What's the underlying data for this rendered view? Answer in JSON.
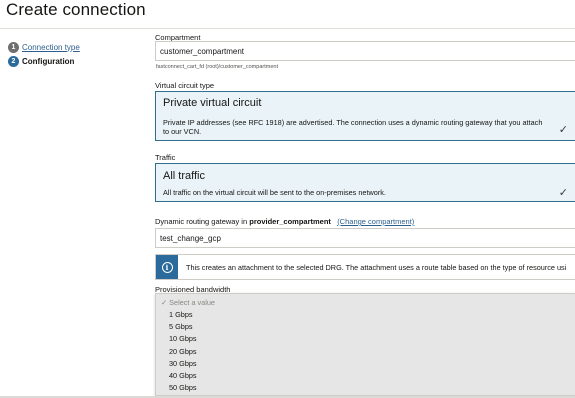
{
  "page": {
    "title": "Create connection"
  },
  "steps": [
    {
      "number": "1",
      "label": "Connection type"
    },
    {
      "number": "2",
      "label": "Configuration"
    }
  ],
  "compartment": {
    "label": "Compartment",
    "value": "customer_compartment",
    "hint": "fastconnect_cart_fd (root)/customer_compartment"
  },
  "virtual_circuit": {
    "label": "Virtual circuit type",
    "title": "Private virtual circuit",
    "description_line1": "Private IP addresses (see RFC 1918) are advertised. The connection uses a dynamic routing gateway that you attach",
    "description_line2": "to our VCN."
  },
  "traffic": {
    "label": "Traffic",
    "title": "All traffic",
    "description": "All traffic on the virtual circuit will be sent to the on-premises network."
  },
  "drg": {
    "label_prefix": "Dynamic routing gateway in",
    "label_compartment": "provider_compartment",
    "change_link": "(Change compartment)",
    "value": "test_change_gcp"
  },
  "info": {
    "text": "This creates an attachment to the selected DRG. The attachment uses a route table based on the type of resource usi"
  },
  "bandwidth": {
    "label": "Provisioned bandwidth",
    "placeholder": "✓ Select a value",
    "options": [
      "1 Gbps",
      "5 Gbps",
      "10 Gbps",
      "20 Gbps",
      "30 Gbps",
      "40 Gbps",
      "50 Gbps"
    ]
  },
  "colors": {
    "accent": "#2a6b9b",
    "card_bg": "#e9f3f8",
    "card_border": "#2f6f90",
    "link": "#2d5f8e"
  }
}
